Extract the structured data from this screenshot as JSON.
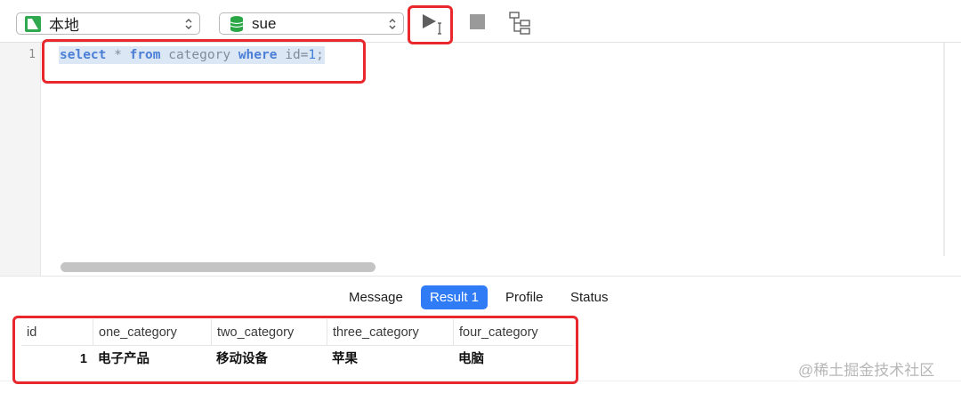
{
  "toolbar": {
    "connection": {
      "label": "本地",
      "icon": "navicat-connection-icon",
      "icon_color": "#2fa84f"
    },
    "database": {
      "label": "sue",
      "icon": "database-icon",
      "icon_color": "#2aa745"
    },
    "run_label": "▶",
    "icons": [
      "run-icon",
      "stop-icon",
      "explain-icon"
    ]
  },
  "editor": {
    "line_number": "1",
    "tokens": [
      {
        "text": "select",
        "kind": "kw"
      },
      {
        "text": " * ",
        "kind": "plain"
      },
      {
        "text": "from",
        "kind": "kw"
      },
      {
        "text": " category ",
        "kind": "plain"
      },
      {
        "text": "where",
        "kind": "kw"
      },
      {
        "text": " id=",
        "kind": "plain"
      },
      {
        "text": "1",
        "kind": "num"
      },
      {
        "text": ";",
        "kind": "plain"
      }
    ]
  },
  "result_tabs": {
    "message": "Message",
    "result": "Result 1",
    "profile": "Profile",
    "status": "Status",
    "active": "Result 1",
    "accent_color": "#2f7cf6"
  },
  "grid": {
    "columns": [
      "id",
      "one_category",
      "two_category",
      "three_category",
      "four_category"
    ],
    "rows": [
      [
        "1",
        "电子产品",
        "移动设备",
        "苹果",
        "电脑"
      ]
    ]
  },
  "annotation_color": "#e8282d",
  "watermark": "@稀土掘金技术社区"
}
